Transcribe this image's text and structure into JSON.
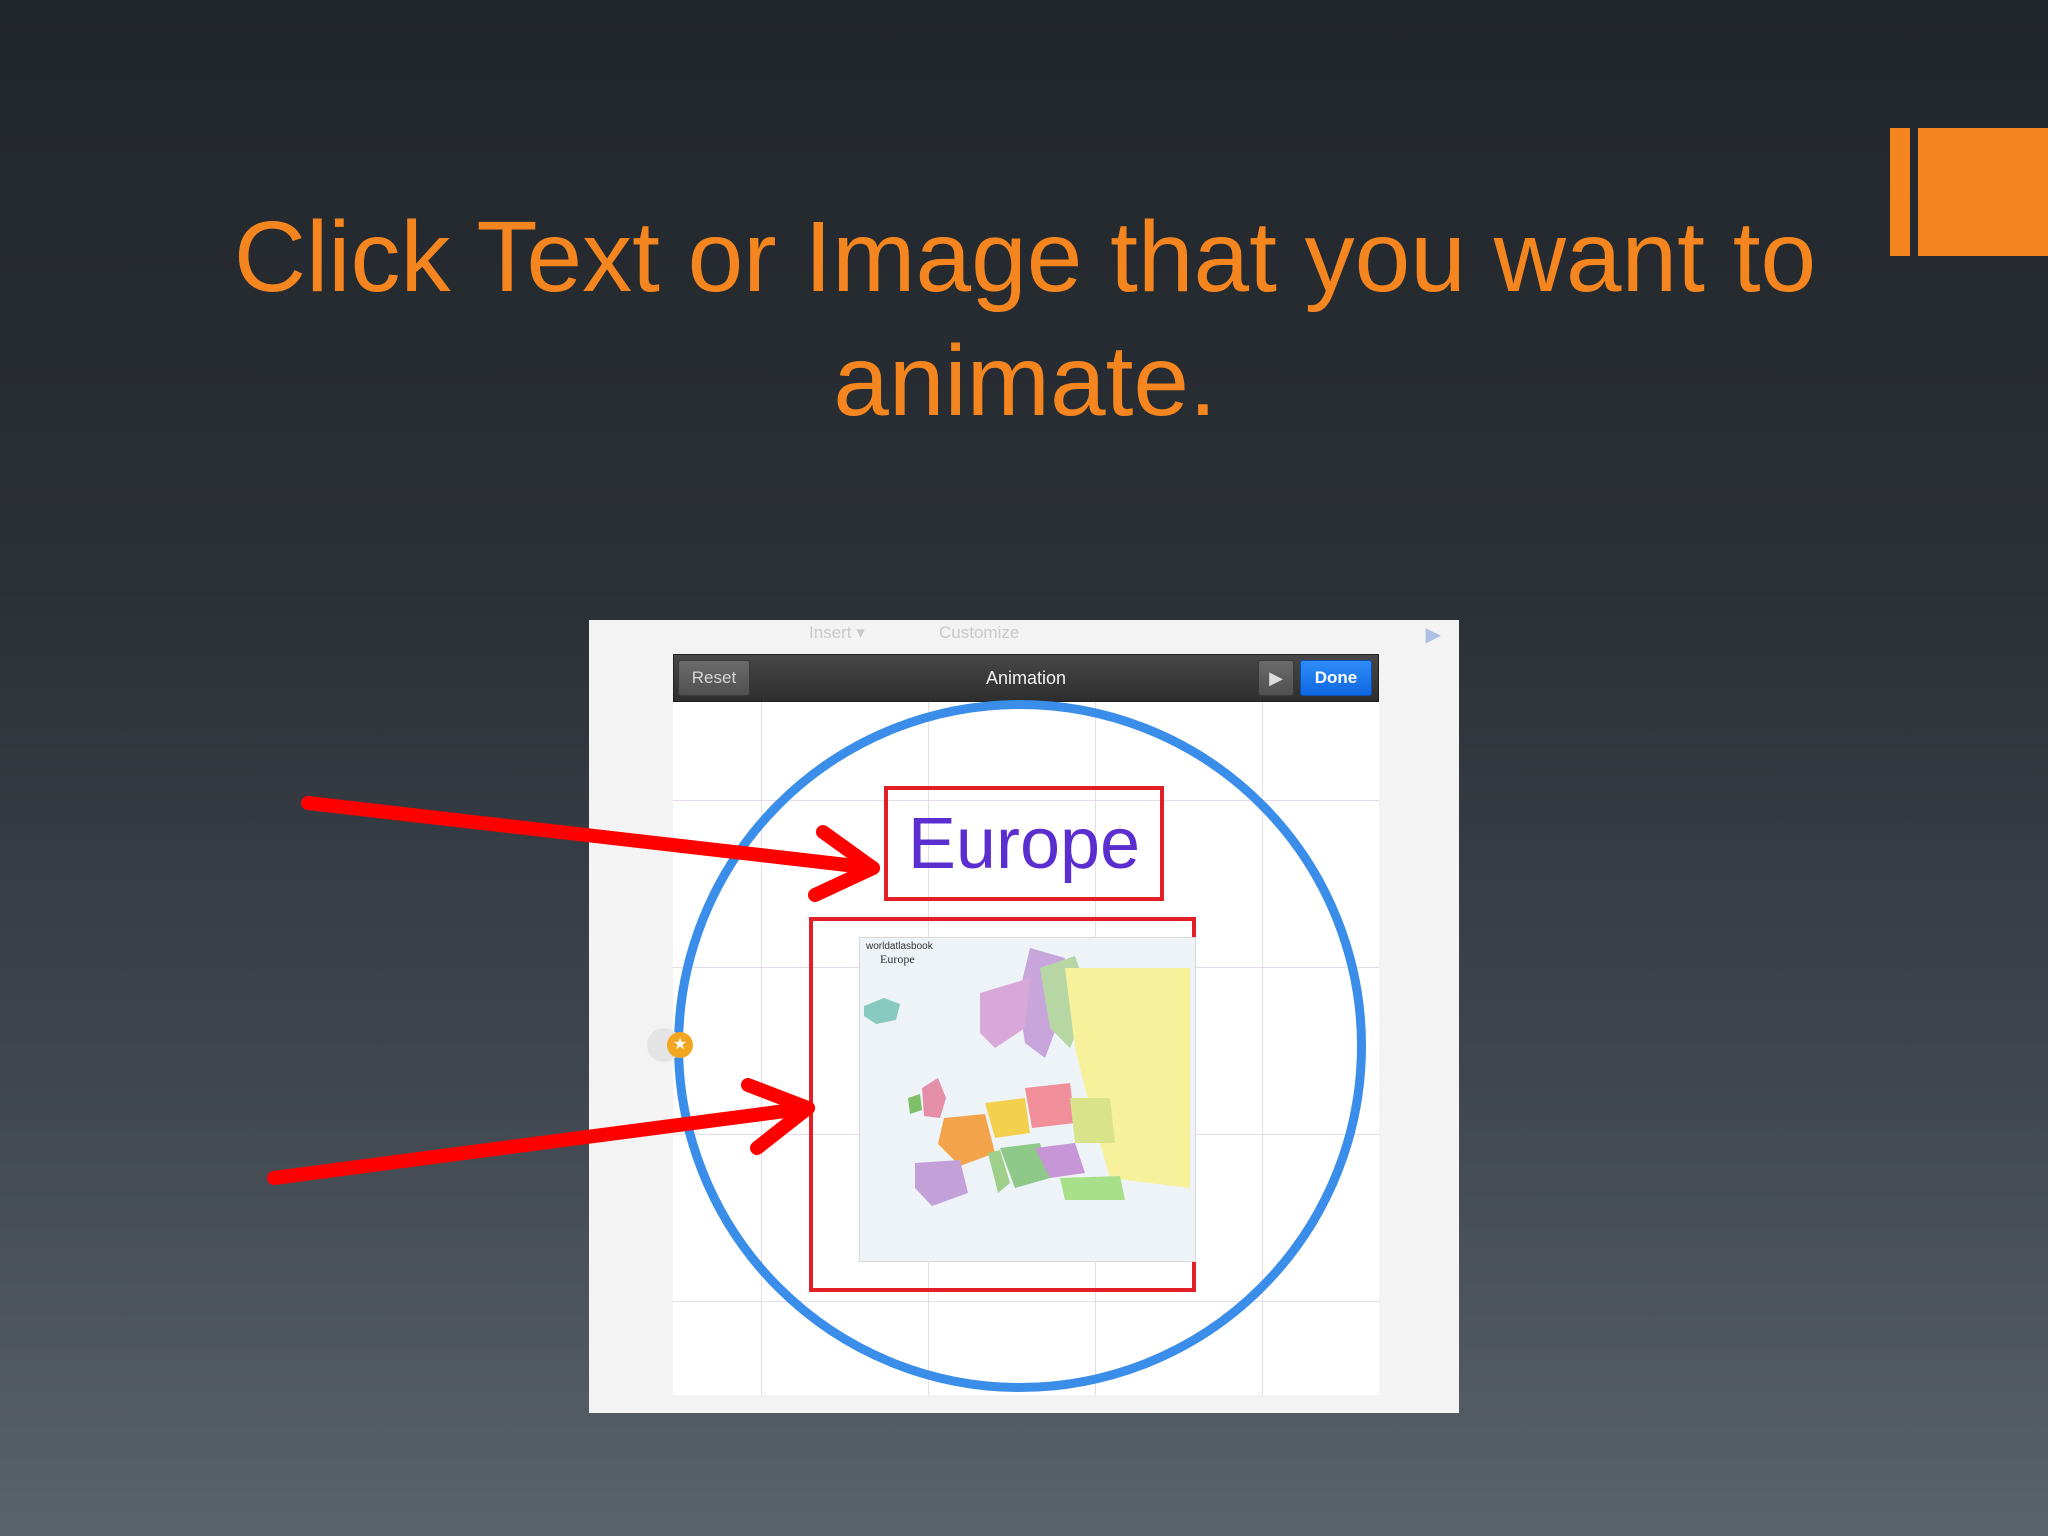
{
  "slide": {
    "title": "Click Text or Image that you want to animate.",
    "accent_color": "#f5861f"
  },
  "screenshot": {
    "ghost_toolbar": {
      "insert_label": "Insert ▾",
      "customize_label": "Customize",
      "play_icon": "play-icon"
    },
    "animation_bar": {
      "reset_label": "Reset",
      "title": "Animation",
      "play_glyph": "▶",
      "done_label": "Done"
    },
    "text_object": {
      "label": "Europe",
      "color": "#5b2fcf"
    },
    "map_object": {
      "brand": "worldatlasbook",
      "name": "Europe"
    },
    "badge_glyph": "★",
    "circle_color": "#3a8de8",
    "highlight_color": "#e21e26"
  },
  "annotations": {
    "arrow_color": "#ff0000"
  }
}
